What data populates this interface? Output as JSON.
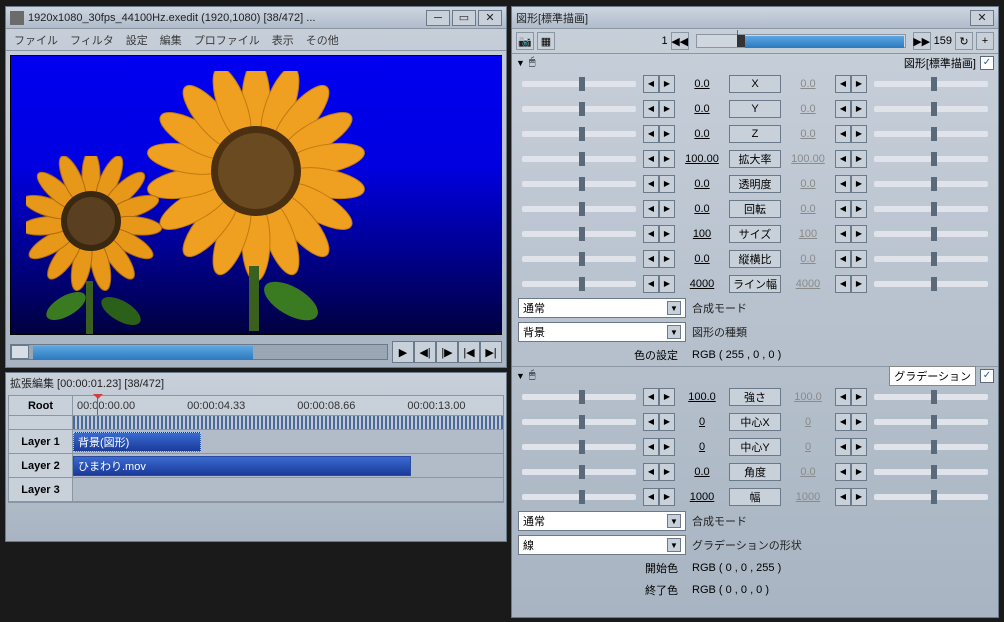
{
  "preview_window": {
    "title": "1920x1080_30fps_44100Hz.exedit (1920,1080) [38/472] ...",
    "menu": [
      "ファイル",
      "フィルタ",
      "設定",
      "編集",
      "プロファイル",
      "表示",
      "その他"
    ]
  },
  "timeline": {
    "title": "拡張編集 [00:00:01.23] [38/472]",
    "root": "Root",
    "times": [
      "00:00:00.00",
      "00:00:04.33",
      "00:00:08.66",
      "00:00:13.00"
    ],
    "layers": [
      "Layer 1",
      "Layer 2",
      "Layer 3"
    ],
    "clips": {
      "layer1": "背景(図形)",
      "layer2": "ひまわり.mov"
    }
  },
  "props": {
    "title": "図形[標準描画]",
    "frame_start": "1",
    "frame_end": "159",
    "section1_label": "図形[標準描画]",
    "rows": [
      {
        "val": "0.0",
        "name": "X",
        "val2": "0.0"
      },
      {
        "val": "0.0",
        "name": "Y",
        "val2": "0.0"
      },
      {
        "val": "0.0",
        "name": "Z",
        "val2": "0.0"
      },
      {
        "val": "100.00",
        "name": "拡大率",
        "val2": "100.00"
      },
      {
        "val": "0.0",
        "name": "透明度",
        "val2": "0.0"
      },
      {
        "val": "0.0",
        "name": "回転",
        "val2": "0.0"
      },
      {
        "val": "100",
        "name": "サイズ",
        "val2": "100"
      },
      {
        "val": "0.0",
        "name": "縦横比",
        "val2": "0.0"
      },
      {
        "val": "4000",
        "name": "ライン幅",
        "val2": "4000"
      }
    ],
    "blend_mode_label": "合成モード",
    "blend_mode_value": "通常",
    "shape_type_label": "図形の種類",
    "shape_type_value": "背景",
    "color_label": "色の設定",
    "color_value": "RGB ( 255 , 0 , 0 )",
    "section2_label": "グラデーション",
    "rows2": [
      {
        "val": "100.0",
        "name": "強さ",
        "val2": "100.0"
      },
      {
        "val": "0",
        "name": "中心X",
        "val2": "0"
      },
      {
        "val": "0",
        "name": "中心Y",
        "val2": "0"
      },
      {
        "val": "0.0",
        "name": "角度",
        "val2": "0.0"
      },
      {
        "val": "1000",
        "name": "幅",
        "val2": "1000"
      }
    ],
    "blend2_label": "合成モード",
    "blend2_value": "通常",
    "grad_shape_label": "グラデーションの形状",
    "grad_shape_value": "線",
    "start_color_label": "開始色",
    "start_color_value": "RGB ( 0 , 0 , 255 )",
    "end_color_label": "終了色",
    "end_color_value": "RGB ( 0 , 0 , 0 )"
  }
}
